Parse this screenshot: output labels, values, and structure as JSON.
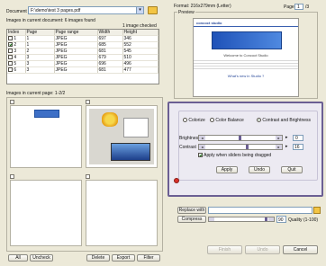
{
  "document": {
    "label": "Document",
    "path": "F:\\demo\\test 3 pages.pdf"
  },
  "images_in_doc": {
    "heading": "Images in current document: 6 images found",
    "checked_info": "1 image checked"
  },
  "table": {
    "columns": [
      "Index",
      "Page",
      "Page range",
      "Width",
      "Height"
    ],
    "rows": [
      {
        "checked": false,
        "index": "1",
        "page": "1",
        "range": "JPEG",
        "width": "697",
        "height": "346"
      },
      {
        "checked": true,
        "index": "2",
        "page": "1",
        "range": "JPEG",
        "width": "685",
        "height": "552"
      },
      {
        "checked": false,
        "index": "3",
        "page": "2",
        "range": "JPEG",
        "width": "681",
        "height": "545"
      },
      {
        "checked": false,
        "index": "4",
        "page": "3",
        "range": "JPEG",
        "width": "679",
        "height": "510"
      },
      {
        "checked": false,
        "index": "5",
        "page": "3",
        "range": "JPEG",
        "width": "696",
        "height": "496"
      },
      {
        "checked": false,
        "index": "6",
        "page": "3",
        "range": "JPEG",
        "width": "681",
        "height": "477"
      }
    ]
  },
  "images_in_page": {
    "heading": "Images in current page: 1-2/2"
  },
  "left_buttons": {
    "all": "All",
    "uncheck": "Uncheck",
    "delete": "Delete",
    "export": "Export",
    "filter": "Filter"
  },
  "format_label": "Format: 216x279mm (Letter)",
  "page_nav": {
    "label": "Page",
    "current": "1",
    "total": "/3"
  },
  "preview": {
    "label": "Preview",
    "logo": "concoct studio",
    "welcome": "Welcome to Concoct Studio",
    "whats_new": "What's new in Studio ?"
  },
  "adjust": {
    "options": [
      {
        "label": "Colorize",
        "selected": false
      },
      {
        "label": "Color Balance",
        "selected": false
      },
      {
        "label": "Contrast and Brightness",
        "selected": true
      }
    ],
    "brightness_label": "Brightness",
    "brightness_value": "0",
    "contrast_label": "Contrast",
    "contrast_value": "16",
    "apply_drag_label": "Apply when sliders being dragged",
    "apply": "Apply",
    "undo": "Undo",
    "quit": "Quit"
  },
  "replace": {
    "button": "Replace with"
  },
  "compress": {
    "button": "Compress",
    "quality_value": "90",
    "quality_label": "Quality (1-100)"
  },
  "bottom_buttons": {
    "finish": "Finish",
    "undo": "Undo",
    "cancel": "Cancel"
  },
  "colors": {
    "accent": "#6b5f93",
    "panel": "#ece9d8",
    "dialog": "#eceaf2"
  }
}
